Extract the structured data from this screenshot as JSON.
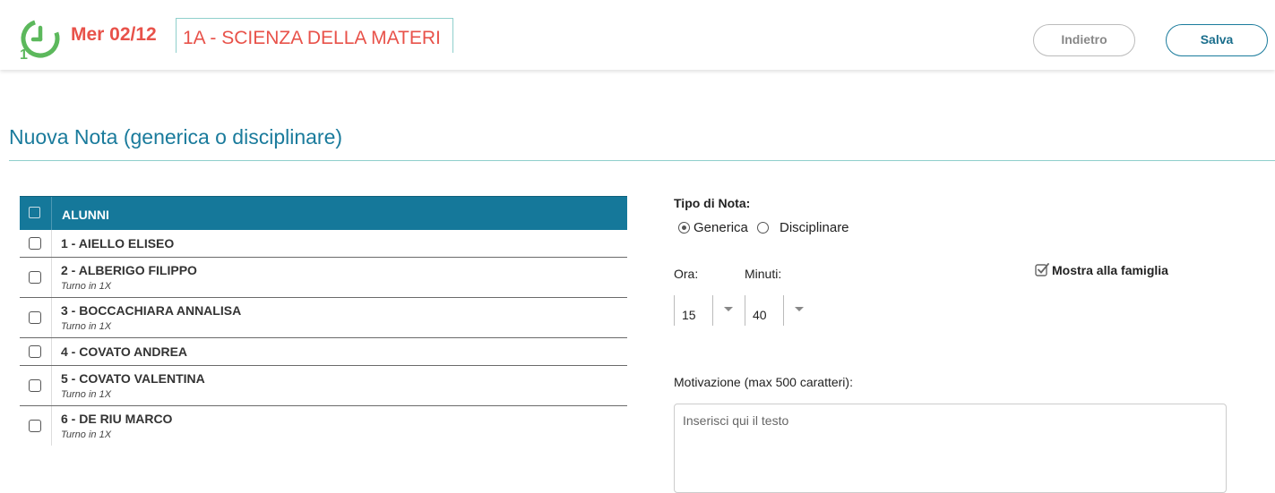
{
  "header": {
    "date": "Mer 02/12",
    "class_label": "1A - SCIENZA DELLA MATERI",
    "back_label": "Indietro",
    "save_label": "Salva"
  },
  "page_title": "Nuova Nota (generica o disciplinare)",
  "students_table": {
    "header": "ALUNNI",
    "rows": [
      {
        "name": "1 - AIELLO ELISEO",
        "note": ""
      },
      {
        "name": "2 - ALBERIGO FILIPPO",
        "note": "Turno in 1X"
      },
      {
        "name": "3 - BOCCACHIARA ANNALISA",
        "note": "Turno in 1X"
      },
      {
        "name": "4 - COVATO ANDREA",
        "note": ""
      },
      {
        "name": "5 - COVATO VALENTINA",
        "note": "Turno in 1X"
      },
      {
        "name": "6 - DE RIU MARCO",
        "note": "Turno in 1X"
      }
    ]
  },
  "form": {
    "tipo_label": "Tipo di Nota:",
    "radio_generica": "Generica",
    "radio_disciplinare": "Disciplinare",
    "ora_label": "Ora:",
    "minuti_label": "Minuti:",
    "ora_value": "15",
    "minuti_value": "40",
    "mostra_label": "Mostra alla famiglia",
    "motivazione_label": "Motivazione (max 500 caratteri):",
    "motivazione_placeholder": "Inserisci qui il testo"
  },
  "colors": {
    "accent": "#15789a",
    "date_red": "#e8524a",
    "logo_green": "#5cb85c"
  }
}
